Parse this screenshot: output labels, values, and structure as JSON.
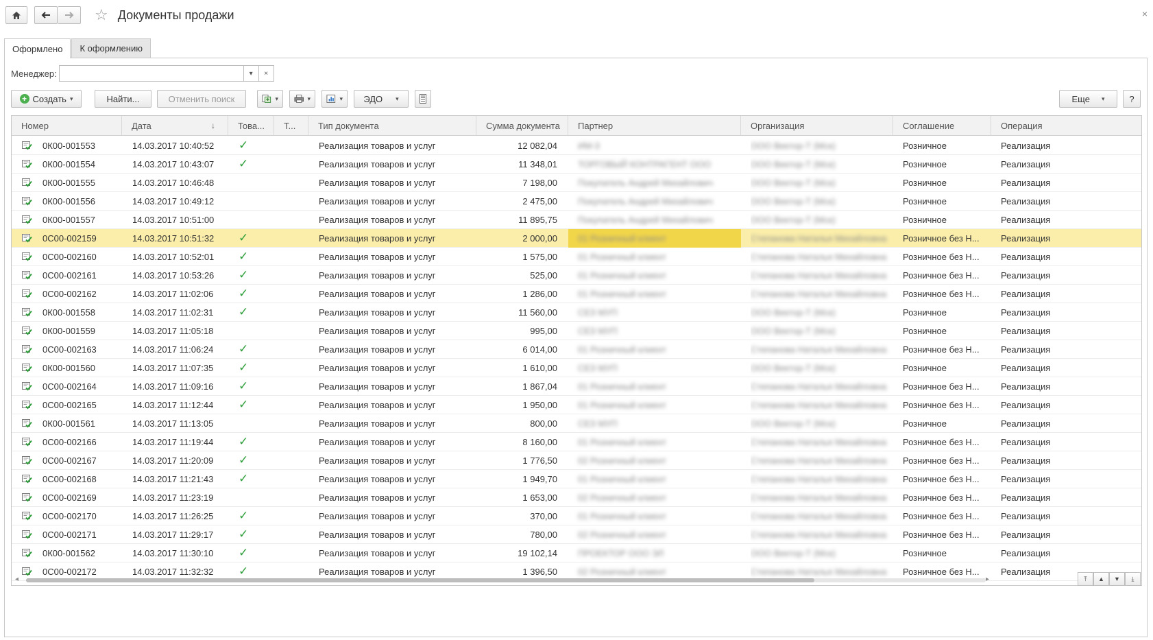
{
  "window": {
    "title": "Документы продажи",
    "close": "×"
  },
  "tabs": [
    {
      "label": "Оформлено",
      "active": true
    },
    {
      "label": "К оформлению",
      "active": false
    }
  ],
  "filter": {
    "label": "Менеджер:",
    "value": "",
    "clear": "×"
  },
  "toolbar": {
    "create": "Создать",
    "find": "Найти...",
    "cancel_search": "Отменить поиск",
    "edo": "ЭДО",
    "more": "Еще",
    "help": "?"
  },
  "table": {
    "headers": {
      "number": "Номер",
      "date": "Дата",
      "goods": "Това...",
      "t": "Т...",
      "doc_type": "Тип документа",
      "sum": "Сумма документа",
      "partner": "Партнер",
      "org": "Организация",
      "agreement": "Соглашение",
      "operation": "Операция"
    },
    "sort_indicator": "↓",
    "rows": [
      {
        "number": "0К00-001553",
        "date": "14.03.2017 10:40:52",
        "check": true,
        "doc_type": "Реализация товаров и услуг",
        "sum": "12 082,04",
        "partner": "ИМ-3",
        "org": "ООО Вектор-Т (Мск)",
        "agreement": "Розничное",
        "operation": "Реализация",
        "selected": false
      },
      {
        "number": "0К00-001554",
        "date": "14.03.2017 10:43:07",
        "check": true,
        "doc_type": "Реализация товаров и услуг",
        "sum": "11 348,01",
        "partner": "ТОРГОВЫЙ КОНТРАГЕНТ ООО",
        "org": "ООО Вектор-Т (Мск)",
        "agreement": "Розничное",
        "operation": "Реализация",
        "selected": false
      },
      {
        "number": "0К00-001555",
        "date": "14.03.2017 10:46:48",
        "check": false,
        "doc_type": "Реализация товаров и услуг",
        "sum": "7 198,00",
        "partner": "Покупатель Андрей Михайлович",
        "org": "ООО Вектор-Т (Мск)",
        "agreement": "Розничное",
        "operation": "Реализация",
        "selected": false
      },
      {
        "number": "0К00-001556",
        "date": "14.03.2017 10:49:12",
        "check": false,
        "doc_type": "Реализация товаров и услуг",
        "sum": "2 475,00",
        "partner": "Покупатель Андрей Михайлович",
        "org": "ООО Вектор-Т (Мск)",
        "agreement": "Розничное",
        "operation": "Реализация",
        "selected": false
      },
      {
        "number": "0К00-001557",
        "date": "14.03.2017 10:51:00",
        "check": false,
        "doc_type": "Реализация товаров и услуг",
        "sum": "11 895,75",
        "partner": "Покупатель Андрей Михайлович",
        "org": "ООО Вектор-Т (Мск)",
        "agreement": "Розничное",
        "operation": "Реализация",
        "selected": false
      },
      {
        "number": "0С00-002159",
        "date": "14.03.2017 10:51:32",
        "check": true,
        "doc_type": "Реализация товаров и услуг",
        "sum": "2 000,00",
        "partner": "01 Розничный клиент",
        "org": "Степанова Наталья Михайловна",
        "agreement": "Розничное без Н...",
        "operation": "Реализация",
        "selected": true
      },
      {
        "number": "0С00-002160",
        "date": "14.03.2017 10:52:01",
        "check": true,
        "doc_type": "Реализация товаров и услуг",
        "sum": "1 575,00",
        "partner": "01 Розничный клиент",
        "org": "Степанова Наталья Михайловна",
        "agreement": "Розничное без Н...",
        "operation": "Реализация",
        "selected": false
      },
      {
        "number": "0С00-002161",
        "date": "14.03.2017 10:53:26",
        "check": true,
        "doc_type": "Реализация товаров и услуг",
        "sum": "525,00",
        "partner": "01 Розничный клиент",
        "org": "Степанова Наталья Михайловна",
        "agreement": "Розничное без Н...",
        "operation": "Реализация",
        "selected": false
      },
      {
        "number": "0С00-002162",
        "date": "14.03.2017 11:02:06",
        "check": true,
        "doc_type": "Реализация товаров и услуг",
        "sum": "1 286,00",
        "partner": "01 Розничный клиент",
        "org": "Степанова Наталья Михайловна",
        "agreement": "Розничное без Н...",
        "operation": "Реализация",
        "selected": false
      },
      {
        "number": "0К00-001558",
        "date": "14.03.2017 11:02:31",
        "check": true,
        "doc_type": "Реализация товаров и услуг",
        "sum": "11 560,00",
        "partner": "СЕЗ МУП",
        "org": "ООО Вектор-Т (Мск)",
        "agreement": "Розничное",
        "operation": "Реализация",
        "selected": false
      },
      {
        "number": "0К00-001559",
        "date": "14.03.2017 11:05:18",
        "check": false,
        "doc_type": "Реализация товаров и услуг",
        "sum": "995,00",
        "partner": "СЕЗ МУП",
        "org": "ООО Вектор-Т (Мск)",
        "agreement": "Розничное",
        "operation": "Реализация",
        "selected": false
      },
      {
        "number": "0С00-002163",
        "date": "14.03.2017 11:06:24",
        "check": true,
        "doc_type": "Реализация товаров и услуг",
        "sum": "6 014,00",
        "partner": "01 Розничный клиент",
        "org": "Степанова Наталья Михайловна",
        "agreement": "Розничное без Н...",
        "operation": "Реализация",
        "selected": false
      },
      {
        "number": "0К00-001560",
        "date": "14.03.2017 11:07:35",
        "check": true,
        "doc_type": "Реализация товаров и услуг",
        "sum": "1 610,00",
        "partner": "СЕЗ МУП",
        "org": "ООО Вектор-Т (Мск)",
        "agreement": "Розничное",
        "operation": "Реализация",
        "selected": false
      },
      {
        "number": "0С00-002164",
        "date": "14.03.2017 11:09:16",
        "check": true,
        "doc_type": "Реализация товаров и услуг",
        "sum": "1 867,04",
        "partner": "01 Розничный клиент",
        "org": "Степанова Наталья Михайловна",
        "agreement": "Розничное без Н...",
        "operation": "Реализация",
        "selected": false
      },
      {
        "number": "0С00-002165",
        "date": "14.03.2017 11:12:44",
        "check": true,
        "doc_type": "Реализация товаров и услуг",
        "sum": "1 950,00",
        "partner": "01 Розничный клиент",
        "org": "Степанова Наталья Михайловна",
        "agreement": "Розничное без Н...",
        "operation": "Реализация",
        "selected": false
      },
      {
        "number": "0К00-001561",
        "date": "14.03.2017 11:13:05",
        "check": false,
        "doc_type": "Реализация товаров и услуг",
        "sum": "800,00",
        "partner": "СЕЗ МУП",
        "org": "ООО Вектор-Т (Мск)",
        "agreement": "Розничное",
        "operation": "Реализация",
        "selected": false
      },
      {
        "number": "0С00-002166",
        "date": "14.03.2017 11:19:44",
        "check": true,
        "doc_type": "Реализация товаров и услуг",
        "sum": "8 160,00",
        "partner": "01 Розничный клиент",
        "org": "Степанова Наталья Михайловна",
        "agreement": "Розничное без Н...",
        "operation": "Реализация",
        "selected": false
      },
      {
        "number": "0С00-002167",
        "date": "14.03.2017 11:20:09",
        "check": true,
        "doc_type": "Реализация товаров и услуг",
        "sum": "1 776,50",
        "partner": "02 Розничный клиент",
        "org": "Степанова Наталья Михайловна",
        "agreement": "Розничное без Н...",
        "operation": "Реализация",
        "selected": false
      },
      {
        "number": "0С00-002168",
        "date": "14.03.2017 11:21:43",
        "check": true,
        "doc_type": "Реализация товаров и услуг",
        "sum": "1 949,70",
        "partner": "01 Розничный клиент",
        "org": "Степанова Наталья Михайловна",
        "agreement": "Розничное без Н...",
        "operation": "Реализация",
        "selected": false
      },
      {
        "number": "0С00-002169",
        "date": "14.03.2017 11:23:19",
        "check": false,
        "doc_type": "Реализация товаров и услуг",
        "sum": "1 653,00",
        "partner": "02 Розничный клиент",
        "org": "Степанова Наталья Михайловна",
        "agreement": "Розничное без Н...",
        "operation": "Реализация",
        "selected": false
      },
      {
        "number": "0С00-002170",
        "date": "14.03.2017 11:26:25",
        "check": true,
        "doc_type": "Реализация товаров и услуг",
        "sum": "370,00",
        "partner": "01 Розничный клиент",
        "org": "Степанова Наталья Михайловна",
        "agreement": "Розничное без Н...",
        "operation": "Реализация",
        "selected": false
      },
      {
        "number": "0С00-002171",
        "date": "14.03.2017 11:29:17",
        "check": true,
        "doc_type": "Реализация товаров и услуг",
        "sum": "780,00",
        "partner": "02 Розничный клиент",
        "org": "Степанова Наталья Михайловна",
        "agreement": "Розничное без Н...",
        "operation": "Реализация",
        "selected": false
      },
      {
        "number": "0К00-001562",
        "date": "14.03.2017 11:30:10",
        "check": true,
        "doc_type": "Реализация товаров и услуг",
        "sum": "19 102,14",
        "partner": "ПРОЕКТОР ООО ЭЛ",
        "org": "ООО Вектор-Т (Мск)",
        "agreement": "Розничное",
        "operation": "Реализация",
        "selected": false
      },
      {
        "number": "0С00-002172",
        "date": "14.03.2017 11:32:32",
        "check": true,
        "doc_type": "Реализация товаров и услуг",
        "sum": "1 396,50",
        "partner": "02 Розничный клиент",
        "org": "Степанова Наталья Михайловна",
        "agreement": "Розничное без Н...",
        "operation": "Реализация",
        "selected": false
      }
    ]
  },
  "icons": {
    "home": "home-icon",
    "back": "arrow-left-icon",
    "forward": "arrow-right-icon",
    "favorite": "star-icon",
    "create": "plus-circle-icon",
    "doc_row": "document-posted-icon",
    "check": "checkmark-icon"
  },
  "colors": {
    "selected_row": "#fbeeaa",
    "selected_partner_cell": "#f2d64a",
    "check": "#2e9e3a",
    "create_icon": "#4caf50"
  }
}
